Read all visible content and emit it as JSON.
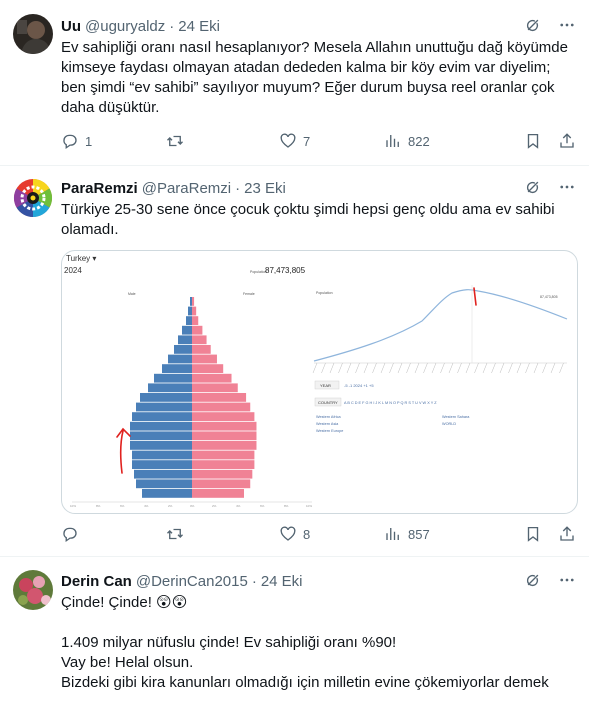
{
  "tweets": [
    {
      "name": "Uu",
      "handle": "@uguryaldz",
      "sep": "·",
      "time": "24 Eki",
      "text_lines": [
        "Ev sahipliği oranı nasıl hesaplanıyor? Mesela Allahın unuttuğu dağ köyümde",
        "kimseye faydası olmayan atadan dededen kalma bir köy evim var diyelim;",
        "ben şimdi “ev sahibi” sayılıyor muyum? Eğer durum buysa reel oranlar çok",
        "daha düşüktür."
      ],
      "replies": "1",
      "retweets": "",
      "likes": "7",
      "views": "822"
    },
    {
      "name": "ParaRemzi",
      "handle": "@ParaRemzi",
      "sep": "·",
      "time": "23 Eki",
      "text_lines": [
        "Türkiye 25-30 sene önce çocuk çoktu şimdi hepsi genç oldu ama ev sahibi",
        "olamadı."
      ],
      "replies": "",
      "retweets": "",
      "likes": "8",
      "views": "857",
      "media": {
        "country": "Turkey ▾",
        "year": "2024",
        "population_label": "Population",
        "population_value": "87,473,805",
        "male_label": "Male",
        "female_label": "Female",
        "line_label": "Population",
        "line_value": "87,473,805",
        "year_button": "YEAR",
        "year_stepper": "-5  -1   2024  +1  +5",
        "country_button": "COUNTRY",
        "alphabet": "A B C D E F G H I J K L M N O P Q R S T U V W X Y Z",
        "regions": [
          "Western Africa",
          "Western Asia",
          "Western Europe",
          "Western Sahara",
          "WORLD"
        ]
      }
    },
    {
      "name": "Derin Can",
      "handle": "@DerinCan2015",
      "sep": "·",
      "time": "24 Eki",
      "text_lines": [
        "Çinde! Çinde! 😲😲",
        "",
        "1.409 milyar nüfuslu çinde! Ev sahipliği oranı %90!",
        "Vay be! Helal olsun.",
        "Bizdeki gibi kira kanunları olmadığı için milletin evine çökemiyorlar demek"
      ]
    }
  ],
  "colors": {
    "male": "#4a7fb8",
    "female": "#f08295",
    "line": "#8fb5dc",
    "annotation": "#e0221f"
  },
  "icons": [
    "grok-icon",
    "more-icon",
    "reply-icon",
    "retweet-icon",
    "like-icon",
    "views-icon",
    "bookmark-icon",
    "share-icon"
  ]
}
